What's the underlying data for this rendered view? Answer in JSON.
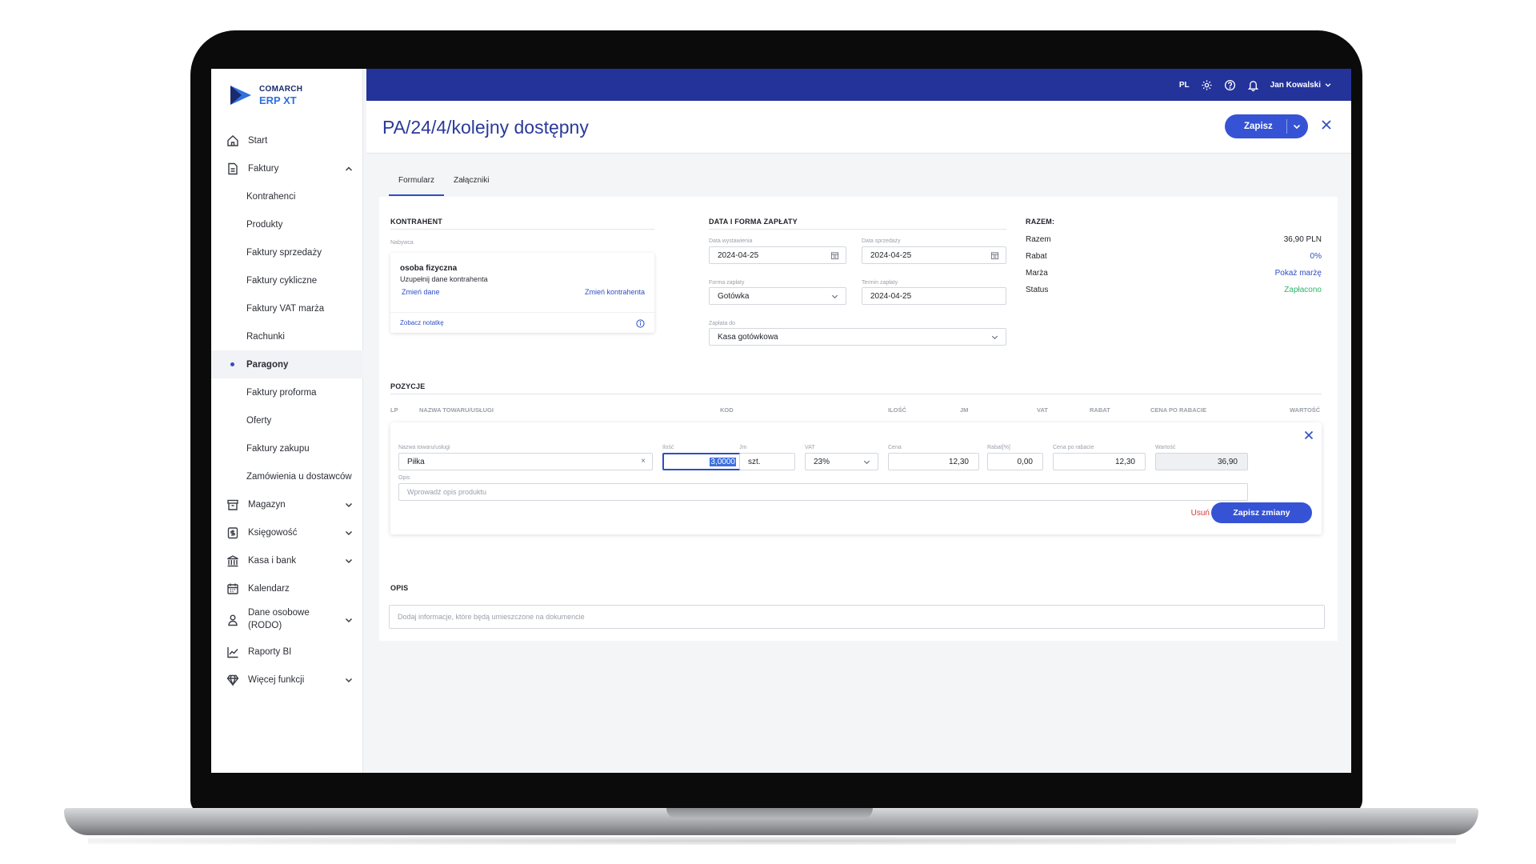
{
  "app": {
    "brand": "COMARCH",
    "product": "ERP XT"
  },
  "sidebar": {
    "items": [
      {
        "label": "Start",
        "icon": "home-icon"
      },
      {
        "label": "Faktury",
        "icon": "invoice-icon",
        "expanded": true
      },
      {
        "label": "Kontrahenci"
      },
      {
        "label": "Produkty"
      },
      {
        "label": "Faktury sprzedaży"
      },
      {
        "label": "Faktury cykliczne"
      },
      {
        "label": "Faktury VAT marża"
      },
      {
        "label": "Rachunki"
      },
      {
        "label": "Paragony",
        "active": true
      },
      {
        "label": "Faktury proforma"
      },
      {
        "label": "Oferty"
      },
      {
        "label": "Faktury zakupu"
      },
      {
        "label": "Zamówienia u dostawców"
      },
      {
        "label": "Magazyn",
        "icon": "warehouse-icon"
      },
      {
        "label": "Księgowość",
        "icon": "accounting-icon"
      },
      {
        "label": "Kasa i bank",
        "icon": "bank-icon"
      },
      {
        "label": "Kalendarz",
        "icon": "calendar-icon"
      },
      {
        "label": "Dane osobowe (RODO)",
        "icon": "person-icon"
      },
      {
        "label": "Raporty BI",
        "icon": "chart-icon"
      },
      {
        "label": "Więcej funkcji",
        "icon": "diamond-icon"
      }
    ]
  },
  "topbar": {
    "language": "PL",
    "user": "Jan Kowalski"
  },
  "header": {
    "title": "PA/24/4/kolejny dostępny",
    "save_label": "Zapisz"
  },
  "tabs": [
    {
      "label": "Formularz",
      "active": true
    },
    {
      "label": "Załączniki"
    }
  ],
  "contractor": {
    "section_title": "KONTRAHENT",
    "buyer_label": "Nabywca",
    "name": "osoba fizyczna",
    "note": "Uzupełnij dane kontrahenta",
    "change_data": "Zmień dane",
    "change_contractor": "Zmień kontrahenta",
    "see_note": "Zobacz notatkę"
  },
  "payment": {
    "section_title": "DATA I FORMA ZAPŁATY",
    "issue_date_label": "Data wystawienia",
    "issue_date": "2024-04-25",
    "sale_date_label": "Data sprzedaży",
    "sale_date": "2024-04-25",
    "method_label": "Forma zapłaty",
    "method": "Gotówka",
    "due_label": "Termin zapłaty",
    "due_date": "2024-04-25",
    "paid_to_label": "Zapłata do",
    "paid_to": "Kasa gotówkowa"
  },
  "summary": {
    "section_title": "RAZEM:",
    "rows": [
      {
        "label": "Razem",
        "value": "36,90  PLN"
      },
      {
        "label": "Rabat",
        "value": "0%"
      },
      {
        "label": "Marża",
        "value": "Pokaż marżę"
      },
      {
        "label": "Status",
        "value": "Zapłacono"
      }
    ],
    "colors": {
      "link": "#2f4fc4",
      "paid": "#2fb56a"
    }
  },
  "positions": {
    "section_title": "POZYCJE",
    "columns": [
      "LP",
      "NAZWA TOWARU/USŁUGI",
      "KOD",
      "ILOŚĆ",
      "JM",
      "VAT",
      "RABAT",
      "CENA PO RABACIE",
      "WARTOŚĆ"
    ],
    "edit": {
      "name_label": "Nazwa towaru/usługi",
      "name": "Piłka",
      "qty_label": "Ilość",
      "qty": "3,0000",
      "unit_label": "Jm",
      "unit": "szt.",
      "vat_label": "VAT",
      "vat": "23%",
      "price_label": "Cena",
      "price": "12,30",
      "discount_label": "Rabat[%]",
      "discount": "0,00",
      "net_price_label": "Cena po rabacie",
      "net_price": "12,30",
      "value_label": "Wartość",
      "value": "36,90",
      "desc_label": "Opis",
      "desc_placeholder": "Wprowadź opis produktu",
      "delete_label": "Usuń",
      "save_label": "Zapisz zmiany"
    }
  },
  "description": {
    "section_title": "OPIS",
    "placeholder": "Dodaj informacje, które będą umieszczone na dokumencie"
  },
  "colors": {
    "topbar": "#24339a",
    "accent": "#3553d4",
    "title": "#2a3a9c",
    "danger": "#d23a3a"
  }
}
